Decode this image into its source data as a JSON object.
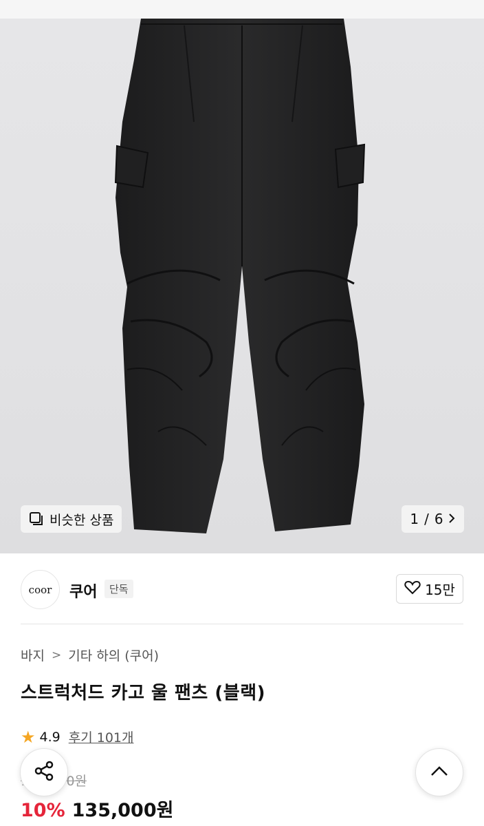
{
  "gallery": {
    "similar_label": "비슷한 상품",
    "pager_current": "1",
    "pager_total": "6"
  },
  "brand": {
    "logo_text": "coor",
    "name": "쿠어",
    "badge": "단독",
    "likes": "15만"
  },
  "breadcrumb": [
    "바지",
    "기타 하의 (쿠어)"
  ],
  "product": {
    "title": "스트럭처드 카고 울 팬츠 (블랙)",
    "rating": "4.9",
    "reviews": "후기 101개",
    "original_price": "150,000원",
    "discount": "10%",
    "price": "135,000원"
  },
  "icons": {
    "similar": "similar-products-icon",
    "pager_next": "chevron-right-icon",
    "like": "heart-icon",
    "star": "star-icon",
    "share": "share-icon",
    "scroll_top": "chevron-up-icon"
  },
  "colors": {
    "discount": "#e5253a",
    "star": "#f5a623"
  }
}
